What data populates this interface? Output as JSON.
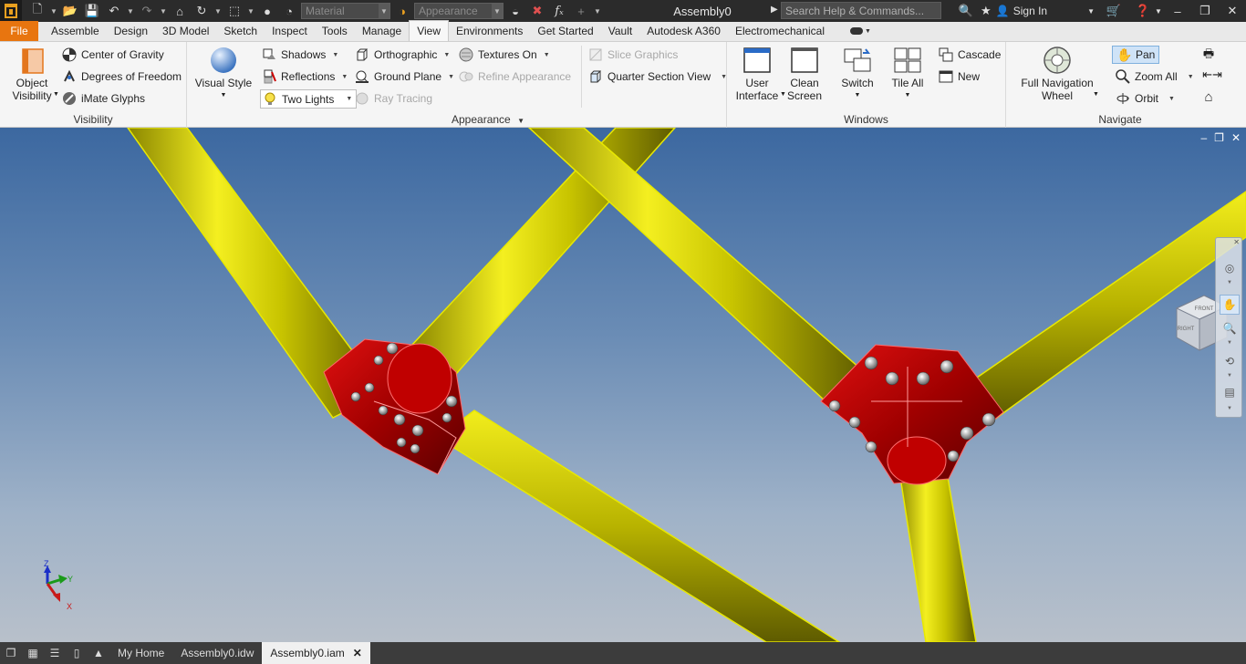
{
  "titlebar": {
    "title": "Assembly0",
    "material_placeholder": "Material",
    "appearance_placeholder": "Appearance",
    "search_placeholder": "Search Help & Commands...",
    "signin_label": "Sign In"
  },
  "tabs": [
    {
      "label": "File"
    },
    {
      "label": "Assemble"
    },
    {
      "label": "Design"
    },
    {
      "label": "3D Model"
    },
    {
      "label": "Sketch"
    },
    {
      "label": "Inspect"
    },
    {
      "label": "Tools"
    },
    {
      "label": "Manage"
    },
    {
      "label": "View"
    },
    {
      "label": "Environments"
    },
    {
      "label": "Get Started"
    },
    {
      "label": "Vault"
    },
    {
      "label": "Autodesk A360"
    },
    {
      "label": "Electromechanical"
    }
  ],
  "active_tab": "View",
  "ribbon": {
    "visibility": {
      "label": "Visibility",
      "object_visibility_line1": "Object",
      "object_visibility_line2": "Visibility",
      "center_of_gravity": "Center of Gravity",
      "degrees_of_freedom": "Degrees of Freedom",
      "imate_glyphs": "iMate Glyphs"
    },
    "appearance": {
      "label": "Appearance",
      "visual_style": "Visual Style",
      "shadows": "Shadows",
      "reflections": "Reflections",
      "two_lights": "Two Lights",
      "orthographic": "Orthographic",
      "ground_plane": "Ground Plane",
      "ray_tracing": "Ray Tracing",
      "textures_on": "Textures On",
      "refine_appearance": "Refine Appearance",
      "slice_graphics": "Slice Graphics",
      "quarter_section_view": "Quarter Section View"
    },
    "windows": {
      "label": "Windows",
      "user_interface_line1": "User",
      "user_interface_line2": "Interface",
      "clean_screen_line1": "Clean",
      "clean_screen_line2": "Screen",
      "switch": "Switch",
      "tile_all": "Tile All",
      "cascade": "Cascade",
      "new": "New"
    },
    "navigate": {
      "label": "Navigate",
      "full_nav_wheel_line1": "Full Navigation",
      "full_nav_wheel_line2": "Wheel",
      "pan": "Pan",
      "zoom_all": "Zoom All",
      "orbit": "Orbit"
    }
  },
  "viewcube": {
    "face_front": "FRONT",
    "face_right": "RIGHT"
  },
  "triad": {
    "x": "X",
    "y": "Y",
    "z": "Z"
  },
  "doc_tabs": [
    {
      "label": "My Home"
    },
    {
      "label": "Assembly0.idw"
    },
    {
      "label": "Assembly0.iam"
    }
  ],
  "colors": {
    "file_tab": "#e8750f",
    "tube_yellow": "#d8d400",
    "connector_red": "#b80000",
    "viewport_top": "#3c68a0",
    "viewport_bottom": "#b8c0ca"
  }
}
